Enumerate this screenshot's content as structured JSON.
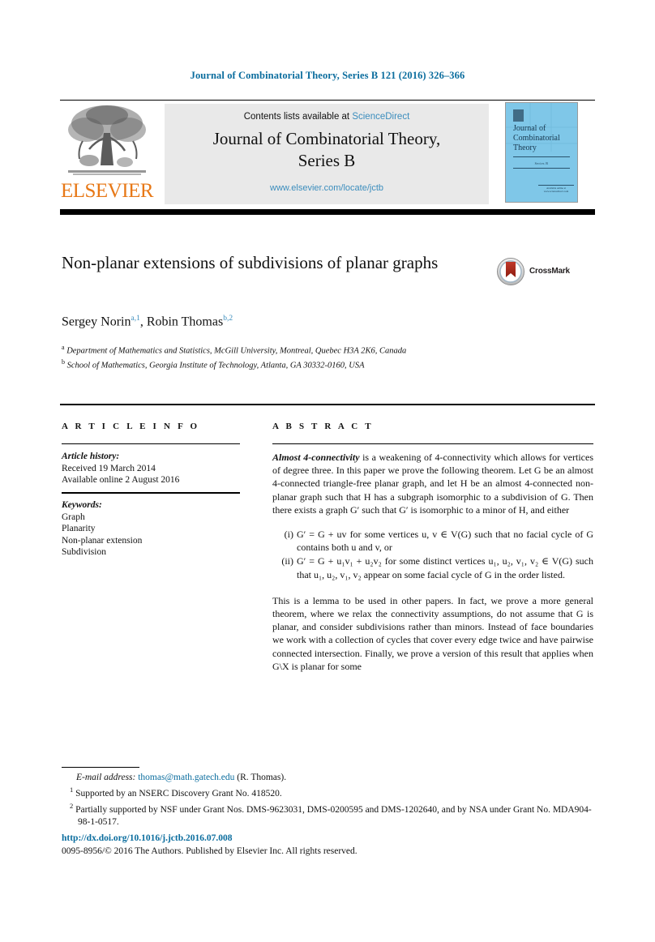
{
  "running_head": "Journal of Combinatorial Theory, Series B 121 (2016) 326–366",
  "masthead": {
    "contents_prefix": "Contents lists available at ",
    "sciencedirect": "ScienceDirect",
    "journal_title_line1": "Journal of Combinatorial Theory,",
    "journal_title_line2": "Series B",
    "journal_url": "www.elsevier.com/locate/jctb",
    "publisher_logo_text": "ELSEVIER",
    "cover": {
      "title": "Journal of Combinatorial Theory",
      "volume_label": "Series B",
      "footer_line": "Available online at www.sciencedirect.com"
    }
  },
  "article": {
    "title": "Non-planar extensions of subdivisions of planar graphs",
    "crossmark_label": "CrossMark",
    "authors": [
      {
        "name": "Sergey Norin",
        "affiliation_mark": "a",
        "note_mark": "1"
      },
      {
        "name": "Robin Thomas",
        "affiliation_mark": "b",
        "note_mark": "2"
      }
    ],
    "affiliations": [
      {
        "mark": "a",
        "text": "Department of Mathematics and Statistics, McGill University, Montreal, Quebec H3A 2K6, Canada"
      },
      {
        "mark": "b",
        "text": "School of Mathematics, Georgia Institute of Technology, Atlanta, GA 30332-0160, USA"
      }
    ]
  },
  "info": {
    "heading": "A R T I C L E   I N F O",
    "history_label": "Article history:",
    "history_lines": [
      "Received 19 March 2014",
      "Available online 2 August 2016"
    ],
    "keywords_label": "Keywords:",
    "keywords": [
      "Graph",
      "Planarity",
      "Non-planar extension",
      "Subdivision"
    ]
  },
  "abstract": {
    "heading": "A B S T R A C T",
    "lead_term": "Almost 4-connectivity",
    "paragraph1_rest": " is a weakening of 4-connectivity which allows for vertices of degree three. In this paper we prove the following theorem. Let G be an almost 4-connected triangle-free planar graph, and let H be an almost 4-connected non-planar graph such that H has a subgraph isomorphic to a subdivision of G. Then there exists a graph G′ such that G′ is isomorphic to a minor of H, and either",
    "items": [
      {
        "marker": "(i)",
        "text": "G′ = G + uv for some vertices u, v ∈ V(G) such that no facial cycle of G contains both u and v, or"
      },
      {
        "marker": "(ii)",
        "text": "G′ = G + u₁v₁ + u₂v₂ for some distinct vertices u₁, u₂, v₁, v₂ ∈ V(G) such that u₁, u₂, v₁, v₂ appear on some facial cycle of G in the order listed."
      }
    ],
    "paragraph2": "This is a lemma to be used in other papers. In fact, we prove a more general theorem, where we relax the connectivity assumptions, do not assume that G is planar, and consider subdivisions rather than minors. Instead of face boundaries we work with a collection of cycles that cover every edge twice and have pairwise connected intersection. Finally, we prove a version of this result that applies when G\\X is planar for some"
  },
  "footnotes": {
    "email_label": "E-mail address:",
    "email": "thomas@math.gatech.edu",
    "email_suffix": "(R. Thomas).",
    "note1_mark": "1",
    "note1": "Supported by an NSERC Discovery Grant No. 418520.",
    "note2_mark": "2",
    "note2": "Partially supported by NSF under Grant Nos. DMS-9623031, DMS-0200595 and DMS-1202640, and by NSA under Grant No. MDA904-98-1-0517."
  },
  "colophon": {
    "doi": "http://dx.doi.org/10.1016/j.jctb.2016.07.008",
    "rights": "0095-8956/© 2016 The Authors. Published by Elsevier Inc. All rights reserved."
  },
  "colors": {
    "link": "#0b6d9e",
    "sciencedirect": "#3b8dbd",
    "elsevier_orange": "#E77817",
    "cover_blue": "#7fc7e8"
  }
}
